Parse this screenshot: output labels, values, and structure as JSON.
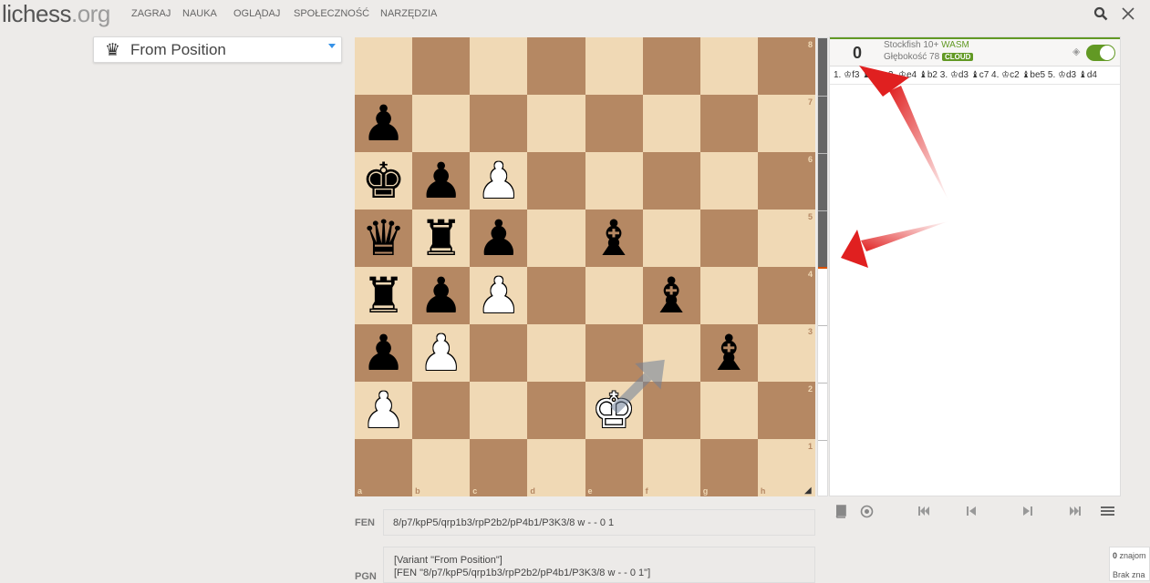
{
  "header": {
    "logo_main": "lichess",
    "logo_tld": ".org",
    "nav": [
      "ZAGRAJ",
      "NAUKA",
      "OGLĄDAJ",
      "SPOŁECZNOŚĆ",
      "NARZĘDZIA"
    ],
    "search_icon": "search-icon",
    "close_icon": "close-icon"
  },
  "variant": {
    "icon": "queen-icon",
    "label": "From Position"
  },
  "board": {
    "ranks": [
      "8",
      "7",
      "6",
      "5",
      "4",
      "3",
      "2",
      "1"
    ],
    "files": [
      "a",
      "b",
      "c",
      "d",
      "e",
      "f",
      "g",
      "h"
    ],
    "rows": [
      [
        "",
        "",
        "",
        "",
        "",
        "",
        "",
        ""
      ],
      [
        "p",
        "",
        "",
        "",
        "",
        "",
        "",
        ""
      ],
      [
        "k",
        "p",
        "P",
        "",
        "",
        "",
        "",
        ""
      ],
      [
        "q",
        "r",
        "p",
        "",
        "b",
        "",
        "",
        ""
      ],
      [
        "r",
        "p",
        "P",
        "",
        "",
        "b",
        "",
        ""
      ],
      [
        "p",
        "P",
        "",
        "",
        "",
        "",
        "b",
        ""
      ],
      [
        "P",
        "",
        "",
        "",
        "K",
        "",
        "",
        ""
      ],
      [
        "",
        "",
        "",
        "",
        "",
        "",
        "",
        ""
      ]
    ],
    "arrow": {
      "from": "e2",
      "to": "f3"
    }
  },
  "engine": {
    "score": "0",
    "name": "Stockfish 10+",
    "wasm": "WASM",
    "depth": "Głębokość 78",
    "cloud": "CLOUD",
    "pv": "1. ♔f3 ♝d5+ 2. ♔e4 ♝b2 3. ♔d3 ♝c7 4. ♔c2 ♝be5 5. ♔d3 ♝d4",
    "evaluation_level": 0.5
  },
  "controls": [
    "book-icon",
    "target-icon",
    "first-icon",
    "prev-icon",
    "next-icon",
    "last-icon",
    "menu-icon"
  ],
  "fen": {
    "label": "FEN",
    "value": "8/p7/kpP5/qrp1b3/rpP2b2/pP4b1/P3K3/8 w - - 0 1"
  },
  "pgn": {
    "label": "PGN",
    "line1": "[Variant \"From Position\"]",
    "line2": "[FEN \"8/p7/kpP5/qrp1b3/rpP2b2/pP4b1/P3K3/8 w - - 0 1\"]"
  },
  "explorer": {
    "count": "0",
    "count_label": "znajom",
    "empty": "Brak zna"
  }
}
